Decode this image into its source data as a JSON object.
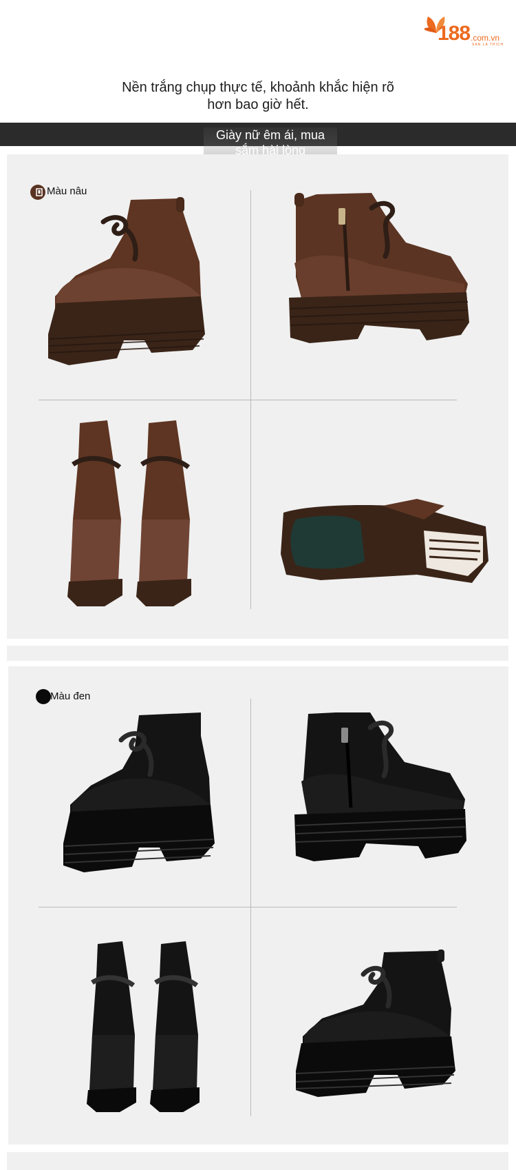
{
  "logo": {
    "number": "188",
    "domain": ".com.vn",
    "tagline": "SAN LA THICH"
  },
  "headline": {
    "line1": "Nền trắng chụp thực tế, khoảnh khắc hiện rõ",
    "line2": "hơn bao giờ hết."
  },
  "banner": {
    "line1": "Giày nữ êm ái, mua",
    "line2": "sắm hài lòng"
  },
  "variants": [
    {
      "label": "Màu nâu",
      "color": "#5a3322"
    },
    {
      "label": "Màu đen",
      "color": "#0a0a0a"
    }
  ],
  "colors": {
    "brand_orange": "#ec6a1f",
    "panel_bg": "#f0f0f0",
    "banner_bg": "#2b2b2b"
  }
}
